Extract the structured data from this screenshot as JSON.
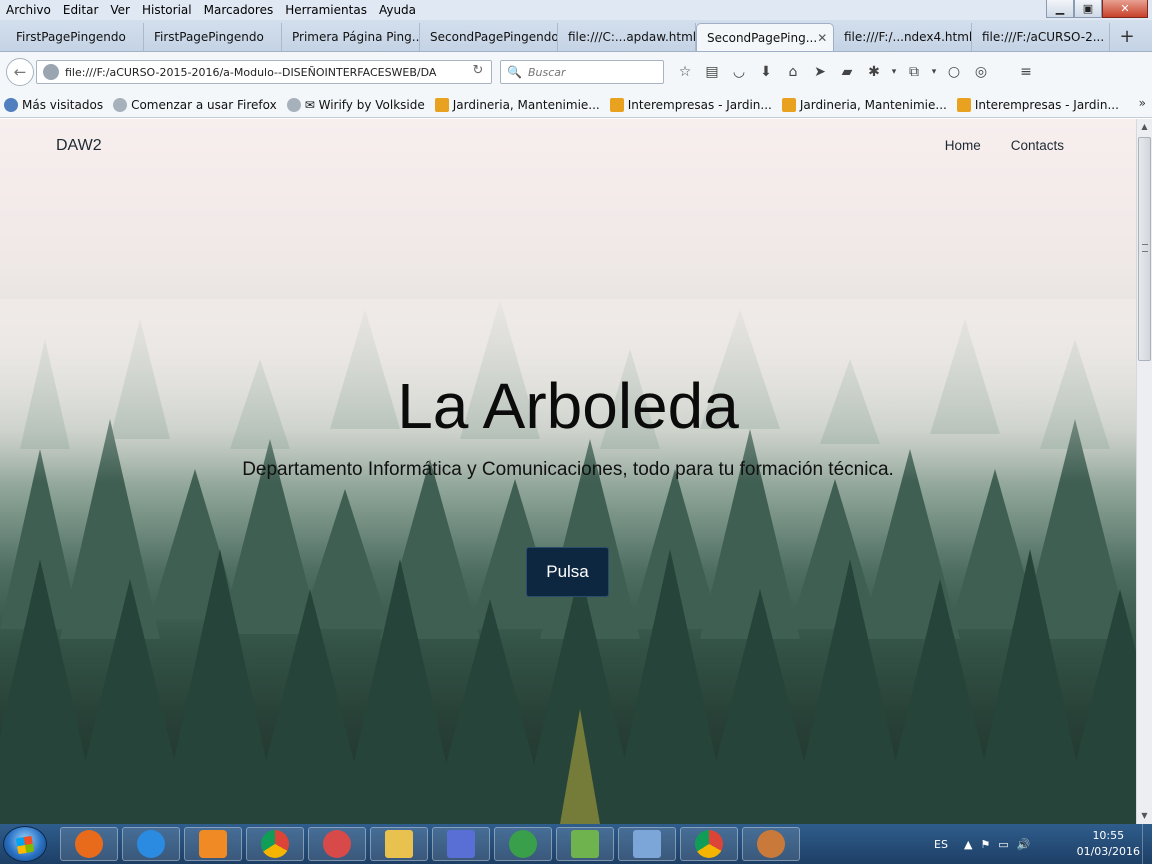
{
  "menubar": {
    "items": [
      "Archivo",
      "Editar",
      "Ver",
      "Historial",
      "Marcadores",
      "Herramientas",
      "Ayuda"
    ]
  },
  "window_controls": {
    "minimize": "▁",
    "maximize": "▣",
    "close": "✕"
  },
  "tabs": [
    {
      "label": "FirstPagePingendo",
      "active": false
    },
    {
      "label": "FirstPagePingendo",
      "active": false
    },
    {
      "label": "Primera Página Ping...",
      "active": false
    },
    {
      "label": "SecondPagePingendo",
      "active": false
    },
    {
      "label": "file:///C:...apdaw.html",
      "active": false
    },
    {
      "label": "SecondPagePing...",
      "active": true
    },
    {
      "label": "file:///F:/...ndex4.html",
      "active": false
    },
    {
      "label": "file:///F:/aCURSO-2...",
      "active": false
    }
  ],
  "tab_close_glyph": "✕",
  "new_tab_glyph": "+",
  "navbar": {
    "back_glyph": "←",
    "url": "file:///F:/aCURSO-2015-2016/a-Modulo--DISEÑOINTERFACESWEB/DA",
    "reload_glyph": "↻",
    "search_placeholder": "Buscar",
    "search_glyph": "🔍",
    "icons": [
      {
        "name": "bookmark-star-icon",
        "glyph": "☆"
      },
      {
        "name": "reading-list-icon",
        "glyph": "▤"
      },
      {
        "name": "pocket-icon",
        "glyph": "◡"
      },
      {
        "name": "download-icon",
        "glyph": "⬇"
      },
      {
        "name": "home-icon",
        "glyph": "⌂"
      },
      {
        "name": "send-icon",
        "glyph": "➤"
      },
      {
        "name": "addon-icon",
        "glyph": "▰"
      },
      {
        "name": "extension-icon",
        "glyph": "✱"
      },
      {
        "name": "dropdown-icon",
        "glyph": "▾"
      },
      {
        "name": "devtools-icon",
        "glyph": "⧉"
      },
      {
        "name": "dropdown-icon-2",
        "glyph": "▾"
      },
      {
        "name": "chat-icon",
        "glyph": "○"
      },
      {
        "name": "globe-icon",
        "glyph": "◎"
      },
      {
        "name": "hamburger-menu-icon",
        "glyph": "≡"
      }
    ]
  },
  "bookmarks": [
    {
      "label": "Más visitados",
      "icon": "ico-blue"
    },
    {
      "label": "Comenzar a usar Firefox",
      "icon": "ico-grey"
    },
    {
      "label": "✉ Wirify by Volkside",
      "icon": "ico-grey"
    },
    {
      "label": "Jardineria, Mantenimie...",
      "icon": "ico-rss"
    },
    {
      "label": "Interempresas - Jardin...",
      "icon": "ico-rss"
    },
    {
      "label": "Jardineria, Mantenimie...",
      "icon": "ico-rss"
    },
    {
      "label": "Interempresas - Jardin...",
      "icon": "ico-rss"
    }
  ],
  "bookmarks_more": "»",
  "page": {
    "brand": "DAW2",
    "nav": [
      "Home",
      "Contacts"
    ],
    "hero_title": "La Arboleda",
    "hero_subtitle": "Departamento Informática y Comunicaciones, todo para tu formación técnica.",
    "hero_button": "Pulsa"
  },
  "scrollbar": {
    "up": "▲",
    "down": "▼"
  },
  "taskbar": {
    "apps": [
      {
        "name": "firefox-icon",
        "color": "#e86b1c"
      },
      {
        "name": "internet-explorer-icon",
        "color": "#2a8be0"
      },
      {
        "name": "media-player-icon",
        "color": "#f08a24"
      },
      {
        "name": "chrome-icon",
        "color": "#3aa757"
      },
      {
        "name": "paint-tool-icon",
        "color": "#d84a4a"
      },
      {
        "name": "file-explorer-icon",
        "color": "#e9c14f"
      },
      {
        "name": "network-app-icon",
        "color": "#5a6fd6"
      },
      {
        "name": "anaconda-icon",
        "color": "#3a9f4a"
      },
      {
        "name": "notepad-icon",
        "color": "#6fb34f"
      },
      {
        "name": "control-panel-icon",
        "color": "#7ca6d8"
      },
      {
        "name": "chrome-icon-2",
        "color": "#3aa757"
      },
      {
        "name": "paint-icon",
        "color": "#c97a3a"
      }
    ],
    "language": "ES",
    "tray_glyphs": [
      "▲",
      "⚑",
      "▭",
      "🔊"
    ],
    "time": "10:55",
    "date": "01/03/2016"
  }
}
